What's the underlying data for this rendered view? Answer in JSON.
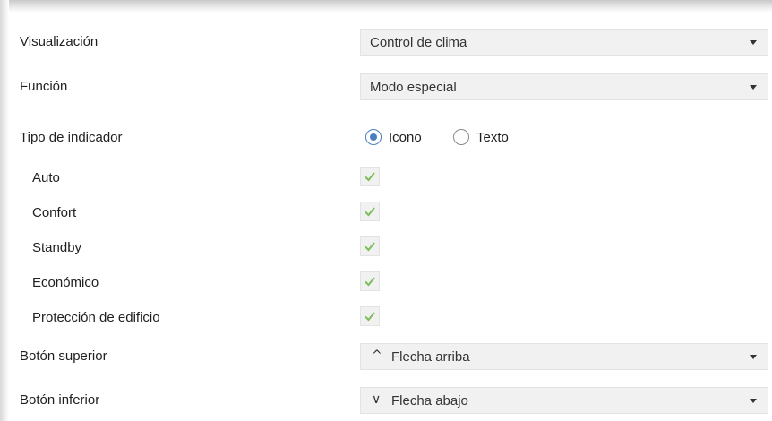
{
  "rows": {
    "visualizacion": {
      "label": "Visualización",
      "value": "Control de clima"
    },
    "funcion": {
      "label": "Función",
      "value": "Modo especial"
    },
    "tipo_indicador": {
      "label": "Tipo de indicador",
      "options": [
        {
          "label": "Icono",
          "selected": true
        },
        {
          "label": "Texto",
          "selected": false
        }
      ]
    },
    "modes": [
      {
        "label": "Auto",
        "checked": true
      },
      {
        "label": "Confort",
        "checked": true
      },
      {
        "label": "Standby",
        "checked": true
      },
      {
        "label": "Económico",
        "checked": true
      },
      {
        "label": "Protección de edificio",
        "checked": true
      }
    ],
    "boton_superior": {
      "label": "Botón superior",
      "glyph": "^",
      "value": "Flecha arriba"
    },
    "boton_inferior": {
      "label": "Botón inferior",
      "glyph": "∨",
      "value": "Flecha abajo"
    }
  },
  "colors": {
    "check": "#7cbf5a",
    "radio_selected": "#4a7fbf",
    "field_bg": "#f1f1f1"
  }
}
